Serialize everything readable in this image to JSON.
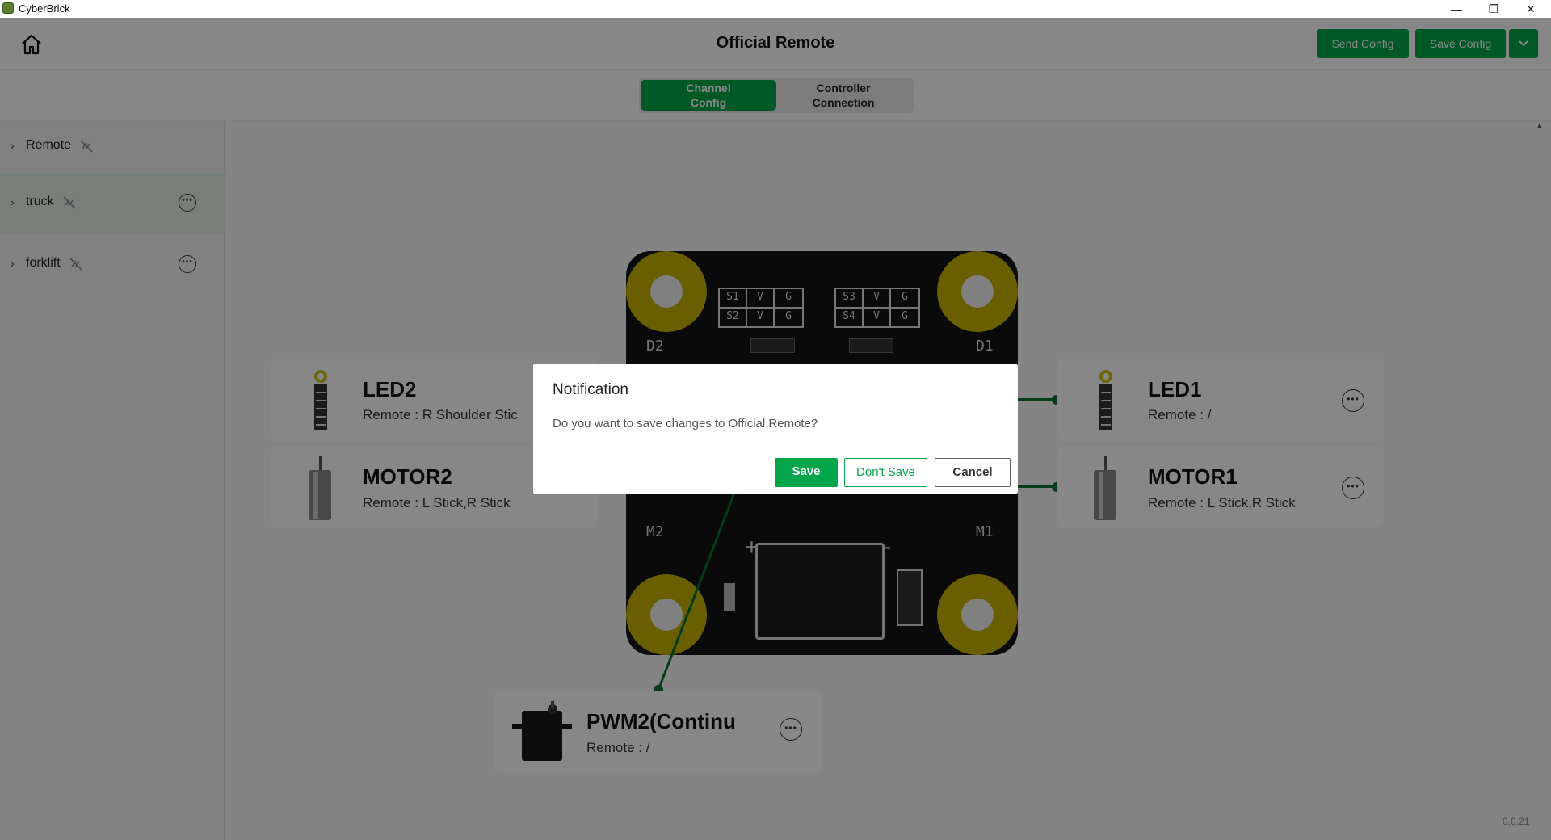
{
  "window": {
    "title": "CyberBrick",
    "minimize": "—",
    "restore": "❐",
    "close": "✕"
  },
  "header": {
    "title": "Official Remote",
    "send_label": "Send Config",
    "save_label": "Save Config",
    "dropdown_icon": "chevron-down-icon"
  },
  "tabs": [
    {
      "label": "Channel\nConfig",
      "active": true
    },
    {
      "label": "Controller\nConnection",
      "active": false
    }
  ],
  "sidebar": {
    "items": [
      {
        "label": "Remote",
        "selected": false,
        "has_more": false
      },
      {
        "label": "truck",
        "selected": true,
        "has_more": true
      },
      {
        "label": "forklift",
        "selected": false,
        "has_more": true
      }
    ]
  },
  "board": {
    "pin_rows_left": [
      [
        "S1",
        "V",
        "G"
      ],
      [
        "S2",
        "V",
        "G"
      ]
    ],
    "pin_rows_right": [
      [
        "S3",
        "V",
        "G"
      ],
      [
        "S4",
        "V",
        "G"
      ]
    ],
    "labels": {
      "d2": "D2",
      "d1": "D1",
      "m2": "M2",
      "m1": "M1",
      "plus": "+",
      "minus": "-"
    }
  },
  "devices": {
    "led2": {
      "name": "LED2",
      "mapping": "Remote : R Shoulder Stic"
    },
    "motor2": {
      "name": "MOTOR2",
      "mapping": "Remote : L Stick,R Stick"
    },
    "led1": {
      "name": "LED1",
      "mapping": "Remote : /"
    },
    "motor1": {
      "name": "MOTOR1",
      "mapping": "Remote : L Stick,R Stick"
    },
    "pwm2": {
      "name": "PWM2(Continu",
      "mapping": "Remote : /"
    }
  },
  "dialog": {
    "title": "Notification",
    "message": "Do you want to save changes to Official Remote?",
    "save_label": "Save",
    "dont_save_label": "Don't Save",
    "cancel_label": "Cancel"
  },
  "version": "0.0.21",
  "colors": {
    "accent": "#03a64a",
    "wire": "#05722f",
    "pad": "#c9b300",
    "board": "#141414"
  }
}
